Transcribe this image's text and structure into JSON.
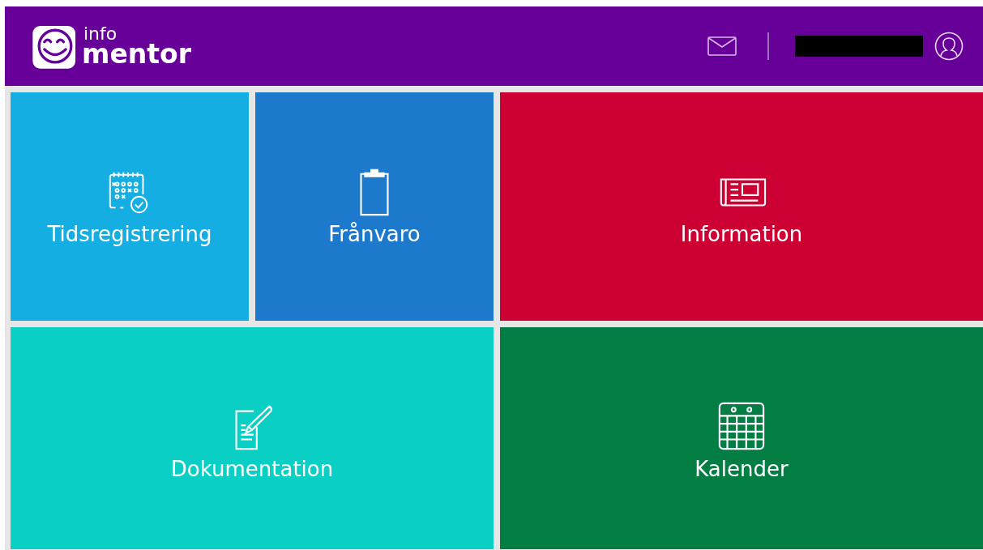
{
  "header": {
    "logo": {
      "top": "info",
      "bottom": "mentor"
    },
    "user_name_redacted": true
  },
  "tiles": [
    {
      "label": "Tidsregistrering",
      "kind": "timesheet",
      "color": "#14aee3"
    },
    {
      "label": "Frånvaro",
      "kind": "clipboard",
      "color": "#1d79cb"
    },
    {
      "label": "Information",
      "kind": "news",
      "color": "#cc0033"
    },
    {
      "label": "Dokumentation",
      "kind": "document",
      "color": "#0acfc5"
    },
    {
      "label": "Kalender",
      "kind": "calendar",
      "color": "#027e45"
    }
  ]
}
